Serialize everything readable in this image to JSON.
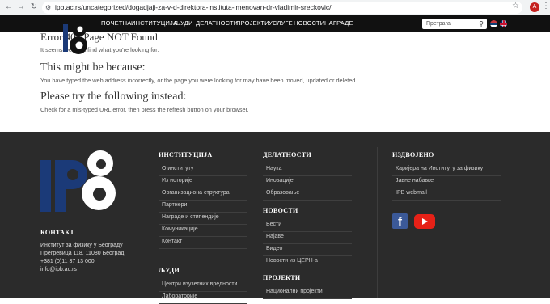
{
  "browser": {
    "url": "ipb.ac.rs/uncategorized/dogadjaji-za-v-d-direktora-instituta-imenovan-dr-vladimir-sreckovic/",
    "profile_initial": "A"
  },
  "menu": {
    "items": [
      "ПОЧЕТНА",
      "ИНСТИТУЦИЈА",
      "ЉУДИ",
      "ДЕЛАТНОСТИ",
      "ПРОЈЕКТИ",
      "УСЛУГЕ",
      "НОВОСТИ",
      "НАГРАДЕ"
    ],
    "search_placeholder": "Претрага"
  },
  "error": {
    "title": "Error 404 Page NOT Found",
    "text": "It seems we can't find what you're looking for.",
    "might_heading": "This might be because:",
    "might_text": "You have typed the web address incorrectly, or the page you were looking for may have been moved, updated or deleted.",
    "try_heading": "Please try the following instead:",
    "try_text": "Check for a mis-typed URL error, then press the refresh button on your browser."
  },
  "footer": {
    "contact_heading": "КОНТАКТ",
    "contact_lines": [
      "Институт за физику у Београду",
      "Прегревица 118, 11080 Београд",
      "+381 (0)11 37 13 000",
      "info@ipb.ac.rs"
    ],
    "institution": {
      "heading": "ИНСТИТУЦИЈА",
      "links": [
        "О институту",
        "Из историје",
        "Организациона структура",
        "Партнери",
        "Награде и стипендије",
        "Комуникације",
        "Контакт"
      ]
    },
    "people": {
      "heading": "ЉУДИ",
      "links": [
        "Центри изузетних вредности",
        "Лабораторије"
      ]
    },
    "activities": {
      "heading": "ДЕЛАТНОСТИ",
      "links": [
        "Наука",
        "Иновације",
        "Образовање"
      ]
    },
    "news": {
      "heading": "НОВОСТИ",
      "links": [
        "Вести",
        "Најаве",
        "Видео",
        "Новости из ЦЕРН-а"
      ]
    },
    "projects": {
      "heading": "ПРОЈЕКТИ",
      "links": [
        "Национални пројекти"
      ]
    },
    "featured": {
      "heading": "ИЗДВОЈЕНО",
      "links": [
        "Каријера на Институту за физику",
        "Јавне набавке",
        "IPB webmail"
      ]
    }
  }
}
